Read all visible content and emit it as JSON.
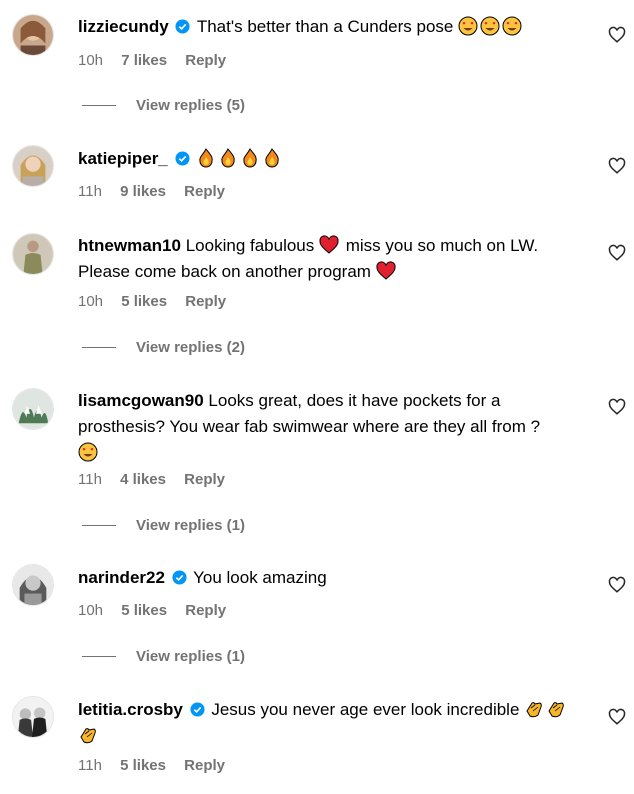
{
  "comments": [
    {
      "username": "lizziecundy",
      "verified": true,
      "text": "That's better than a Cunders pose",
      "emojis": [
        "heart-eyes",
        "heart-eyes",
        "heart-eyes"
      ],
      "time": "10h",
      "likes": "7 likes",
      "reply": "Reply",
      "replies": "View replies (5)"
    },
    {
      "username": "katiepiper_",
      "verified": true,
      "text": "",
      "emojis": [
        "fire",
        "fire",
        "fire",
        "fire"
      ],
      "time": "11h",
      "likes": "9 likes",
      "reply": "Reply"
    },
    {
      "username": "htnewman10",
      "verified": false,
      "text_1": "Looking fabulous",
      "text_2": "miss you so much on LW.",
      "text_3": "Please come back on another program",
      "time": "10h",
      "likes": "5 likes",
      "reply": "Reply",
      "replies": "View replies (2)"
    },
    {
      "username": "lisamcgowan90",
      "verified": false,
      "text_1": "Looks great, does it have pockets for a",
      "text_2": "prosthesis? You wear fab swimwear where are they all from ?",
      "time": "11h",
      "likes": "4 likes",
      "reply": "Reply",
      "replies": "View replies (1)"
    },
    {
      "username": "narinder22",
      "verified": true,
      "text": "You look amazing",
      "time": "10h",
      "likes": "5 likes",
      "reply": "Reply",
      "replies": "View replies (1)"
    },
    {
      "username": "letitia.crosby",
      "verified": true,
      "text": "Jesus you never age ever look incredible",
      "time": "11h",
      "likes": "5 likes",
      "reply": "Reply"
    }
  ],
  "colors": {
    "verified": "#0095f6",
    "meta": "#737373",
    "heart_red": "#e0245e"
  }
}
